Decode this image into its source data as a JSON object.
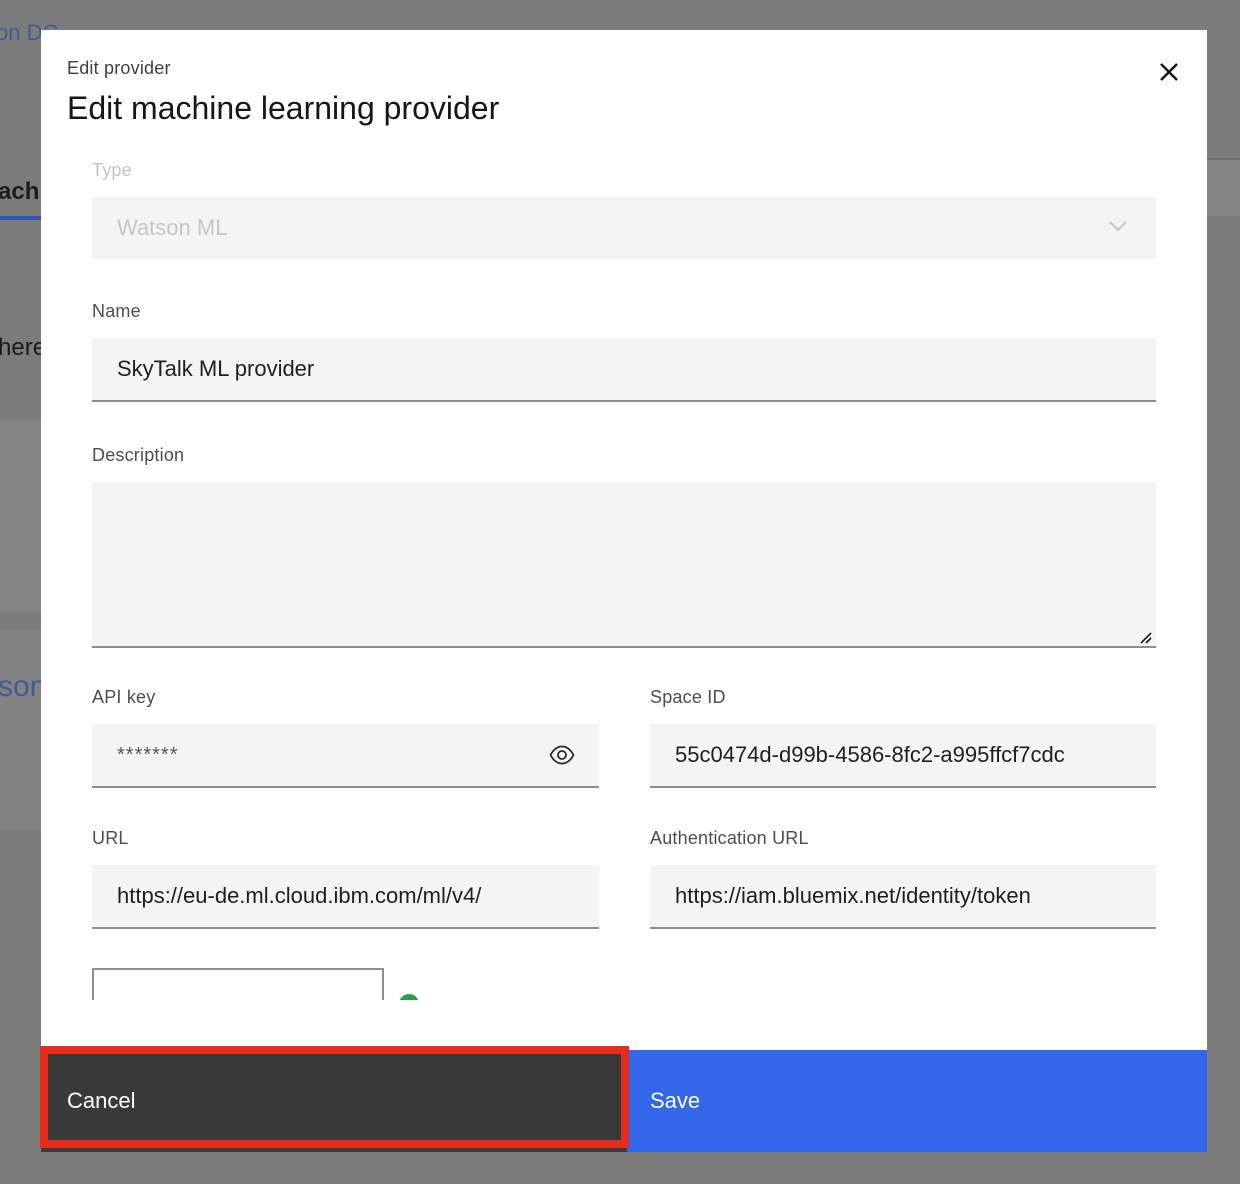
{
  "background": {
    "link_fragment": "on DC",
    "tab_fragment": "ach",
    "text_fragment": "here",
    "json_fragment": "son"
  },
  "modal": {
    "label": "Edit provider",
    "title": "Edit machine learning provider",
    "close_icon": "close-icon"
  },
  "form": {
    "type": {
      "label": "Type",
      "value": "Watson ML",
      "disabled": true
    },
    "name": {
      "label": "Name",
      "value": "SkyTalk ML provider"
    },
    "description": {
      "label": "Description",
      "value": ""
    },
    "api_key": {
      "label": "API key",
      "value": "*******"
    },
    "space_id": {
      "label": "Space ID",
      "value": "55c0474d-d99b-4586-8fc2-a995ffcf7cdc"
    },
    "url": {
      "label": "URL",
      "value": "https://eu-de.ml.cloud.ibm.com/ml/v4/"
    },
    "auth_url": {
      "label": "Authentication URL",
      "value": "https://iam.bluemix.net/identity/token"
    }
  },
  "footer": {
    "cancel_label": "Cancel",
    "save_label": "Save"
  },
  "colors": {
    "primary": "#3366e8",
    "secondary": "#393939",
    "highlight": "#e52d1e",
    "success": "#24a148"
  }
}
